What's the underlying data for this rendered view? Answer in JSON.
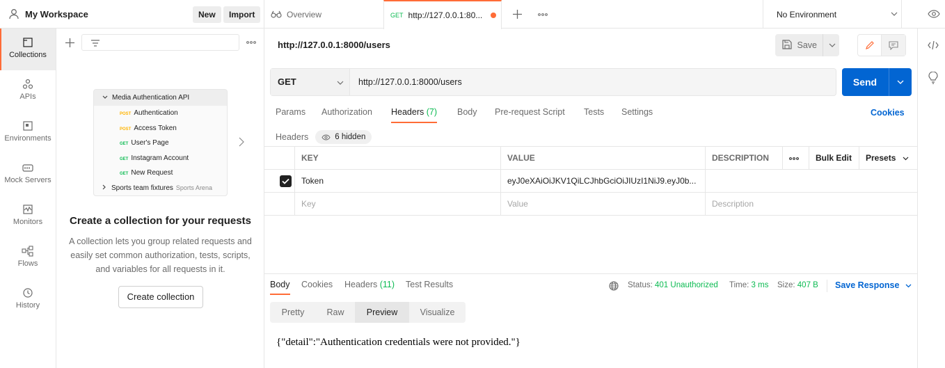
{
  "workspace": {
    "title": "My Workspace",
    "new_label": "New",
    "import_label": "Import"
  },
  "rail": [
    {
      "label": "Collections",
      "icon": "collections-icon"
    },
    {
      "label": "APIs",
      "icon": "apis-icon"
    },
    {
      "label": "Environments",
      "icon": "environments-icon"
    },
    {
      "label": "Mock Servers",
      "icon": "mock-servers-icon"
    },
    {
      "label": "Monitors",
      "icon": "monitors-icon"
    },
    {
      "label": "Flows",
      "icon": "flows-icon"
    },
    {
      "label": "History",
      "icon": "history-icon"
    }
  ],
  "sidebar": {
    "illustration": {
      "folder": "Media Authentication API",
      "requests": [
        {
          "method": "POST",
          "name": "Authentication"
        },
        {
          "method": "POST",
          "name": "Access Token"
        },
        {
          "method": "GET",
          "name": "User's Page"
        },
        {
          "method": "GET",
          "name": "Instagram Account"
        },
        {
          "method": "GET",
          "name": "New Request"
        }
      ],
      "footer": "Sports team fixtures",
      "footer_sub": "Sports Arena"
    },
    "heading": "Create a collection for your requests",
    "description": "A collection lets you group related requests and easily set common authorization, tests, scripts, and variables for all requests in it.",
    "create_label": "Create collection"
  },
  "tabs": {
    "overview": "Overview",
    "active_method": "GET",
    "active_title": "http://127.0.0.1:80...",
    "environment": "No Environment"
  },
  "request": {
    "name": "http://127.0.0.1:8000/users",
    "save_label": "Save",
    "method": "GET",
    "url": "http://127.0.0.1:8000/users",
    "send_label": "Send",
    "tabs": [
      "Params",
      "Authorization",
      "Headers",
      "Body",
      "Pre-request Script",
      "Tests",
      "Settings"
    ],
    "headers_count": "(7)",
    "cookies_label": "Cookies",
    "headers_label": "Headers",
    "hidden_label": "6 hidden"
  },
  "table": {
    "columns": [
      "KEY",
      "VALUE",
      "DESCRIPTION"
    ],
    "bulk_edit": "Bulk Edit",
    "presets": "Presets",
    "rows": [
      {
        "key": "Token",
        "value": "eyJ0eXAiOiJKV1QiLCJhbGciOiJIUzI1NiJ9.eyJ0b...",
        "description": ""
      }
    ],
    "placeholders": {
      "key": "Key",
      "value": "Value",
      "description": "Description"
    }
  },
  "response": {
    "tabs": [
      "Body",
      "Cookies",
      "Headers",
      "Test Results"
    ],
    "headers_count": "(11)",
    "status_label": "Status:",
    "status": "401 Unauthorized",
    "time_label": "Time:",
    "time": "3 ms",
    "size_label": "Size:",
    "size": "407 B",
    "save_response": "Save Response",
    "views": [
      "Pretty",
      "Raw",
      "Preview",
      "Visualize"
    ],
    "body": "{\"detail\":\"Authentication credentials were not provided.\"}"
  },
  "colors": {
    "accent": "#ff6c37",
    "primary": "#0265d2",
    "success": "#0cbb52"
  }
}
